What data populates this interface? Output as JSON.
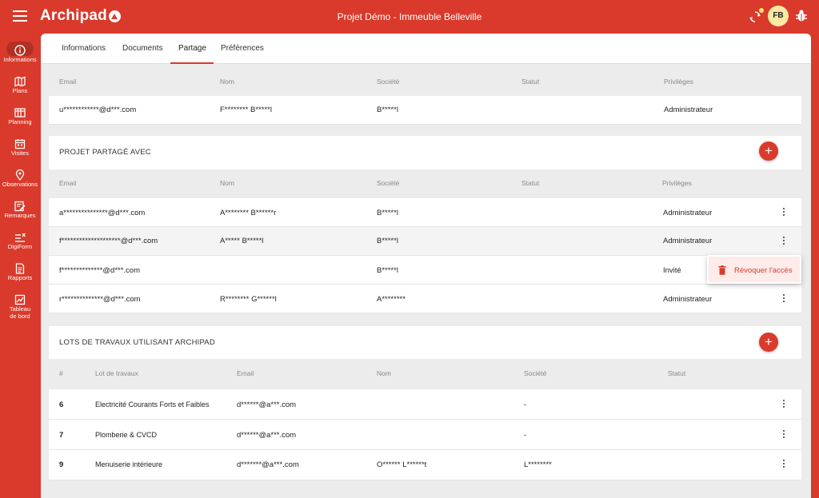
{
  "app": {
    "name": "Archipad",
    "project_title": "Projet Démo - Immeuble Belleville",
    "user_initials": "FB"
  },
  "icons": {
    "menu": "hamburger-icon",
    "sync": "sync-icon",
    "bug": "bug-icon",
    "trash": "trash-icon",
    "more": "kebab-icon",
    "add": "plus-icon"
  },
  "colors": {
    "brand": "#d93a2b",
    "avatar": "#fde9a3",
    "sync_badge": "#fde272",
    "highlight": "#fdecea"
  },
  "sidebar": {
    "items": [
      {
        "label": "Informations",
        "icon": "info-icon"
      },
      {
        "label": "Plans",
        "icon": "map-icon"
      },
      {
        "label": "Planning",
        "icon": "gantt-icon"
      },
      {
        "label": "Visites",
        "icon": "calendar-icon"
      },
      {
        "label": "Observations",
        "icon": "pin-icon"
      },
      {
        "label": "Remarques",
        "icon": "note-edit-icon"
      },
      {
        "label": "DigiForm",
        "icon": "form-icon"
      },
      {
        "label": "Rapports",
        "icon": "report-icon"
      },
      {
        "label": "Tableau de bord",
        "icon": "chart-icon"
      }
    ]
  },
  "tabs": [
    "Informations",
    "Documents",
    "Partage",
    "Préférences"
  ],
  "owner": {
    "headers": [
      "Email",
      "Nom",
      "Société",
      "Statut",
      "Privilèges"
    ],
    "row": {
      "email": "u************@d***.com",
      "nom": "F******** B*****l",
      "societe": "B*****l",
      "statut": "",
      "privileges": "Administrateur"
    }
  },
  "shared": {
    "title": "PROJET PARTAGÉ AVEC",
    "add_label": "+",
    "headers": [
      "Email",
      "Nom",
      "Société",
      "Statut",
      "Privilèges"
    ],
    "rows": [
      {
        "email": "a***************@d***.com",
        "nom": "A******** B******r",
        "societe": "B*****l",
        "statut": "",
        "privileges": "Administrateur"
      },
      {
        "email": "f********************@d***.com",
        "nom": "A***** B*****l",
        "societe": "B*****l",
        "statut": "",
        "privileges": "Administrateur"
      },
      {
        "email": "f**************@d***.com",
        "nom": "",
        "societe": "B*****l",
        "statut": "",
        "privileges": "Invité"
      },
      {
        "email": "r**************@d***.com",
        "nom": "R******** G******l",
        "societe": "A********",
        "statut": "",
        "privileges": "Administrateur"
      }
    ],
    "menu": {
      "revoke_label": "Révoquer l'accès"
    }
  },
  "lots": {
    "title": "LOTS DE TRAVAUX UTILISANT ARCHIPAD",
    "add_label": "+",
    "headers": [
      "#",
      "Lot de travaux",
      "Email",
      "Nom",
      "Société",
      "Statut"
    ],
    "rows": [
      {
        "num": "6",
        "lot": "Electricité Courants Forts et Faibles",
        "email": "d******@a***.com",
        "nom": "",
        "societe": "-",
        "statut": ""
      },
      {
        "num": "7",
        "lot": "Plomberie & CVCD",
        "email": "d******@a***.com",
        "nom": "",
        "societe": "-",
        "statut": ""
      },
      {
        "num": "9",
        "lot": "Menuiserie intérieure",
        "email": "d*******@a***.com",
        "nom": "O****** L******t",
        "societe": "L********",
        "statut": ""
      }
    ]
  }
}
